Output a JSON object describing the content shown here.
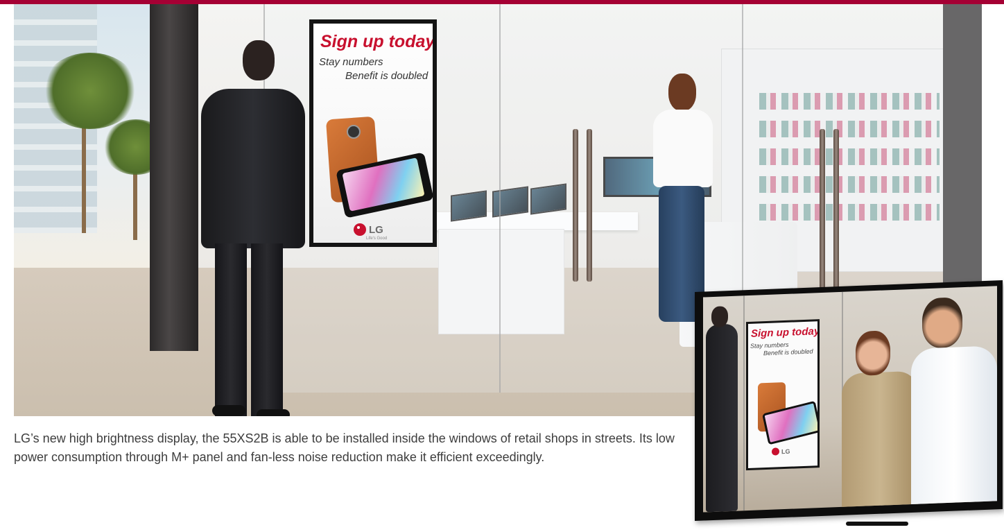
{
  "colors": {
    "brand_red": "#a50034",
    "sign_headline": "#c8102e",
    "caption_text": "#3d3d3d"
  },
  "store_photo": {
    "sign": {
      "headline": "Sign up today!",
      "line1": "Stay numbers",
      "line2": "Benefit is doubled",
      "logo_text": "LG",
      "logo_tagline": "Life's Good"
    }
  },
  "caption": {
    "text": "LG’s new high brightness display, the 55XS2B is able to be installed inside the windows of retail shops in streets. Its low power consumption through M+ panel and fan-less noise reduction make it efficient exceedingly."
  },
  "product_display": {
    "sign": {
      "headline": "Sign up today!",
      "line1": "Stay numbers",
      "line2": "Benefit is doubled",
      "logo_text": "LG"
    }
  }
}
